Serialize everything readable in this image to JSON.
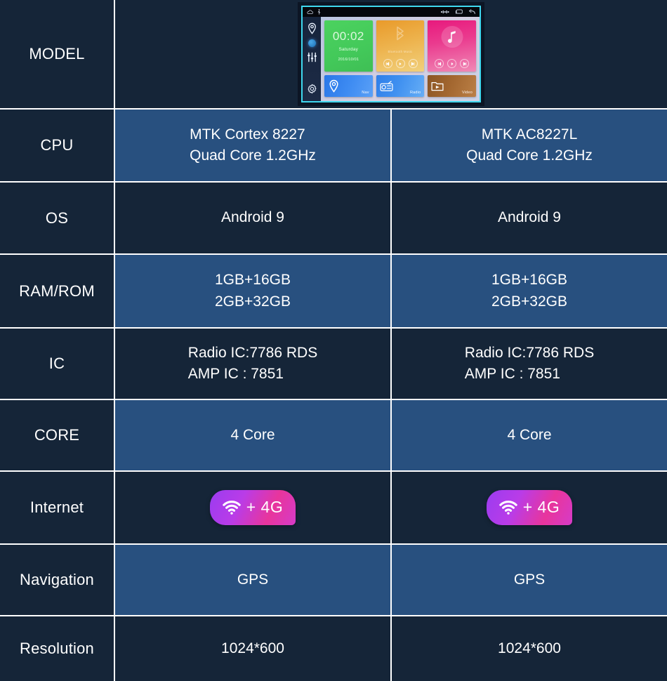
{
  "table": {
    "rows": [
      {
        "label": "MODEL",
        "type": "media",
        "col1": "",
        "col2": ""
      },
      {
        "label": "CPU",
        "type": "text-left",
        "highlight": true,
        "col1_lines": [
          "MTK Cortex 8227",
          "Quad Core 1.2GHz"
        ],
        "col2_lines": [
          "MTK AC8227L",
          "Quad Core 1.2GHz"
        ]
      },
      {
        "label": "OS",
        "type": "text",
        "highlight": false,
        "col1_lines": [
          "Android 9"
        ],
        "col2_lines": [
          "Android 9"
        ]
      },
      {
        "label": "RAM/ROM",
        "type": "text",
        "highlight": true,
        "col1_lines": [
          "1GB+16GB",
          "2GB+32GB"
        ],
        "col2_lines": [
          "1GB+16GB",
          "2GB+32GB"
        ]
      },
      {
        "label": "IC",
        "type": "text-left",
        "highlight": false,
        "col1_lines": [
          "Radio IC:7786 RDS",
          "AMP IC : 7851"
        ],
        "col2_lines": [
          "Radio IC:7786 RDS",
          "AMP IC : 7851"
        ]
      },
      {
        "label": "CORE",
        "type": "text",
        "highlight": true,
        "col1_lines": [
          "4 Core"
        ],
        "col2_lines": [
          "4 Core"
        ]
      },
      {
        "label": "Internet",
        "type": "badge",
        "highlight": false,
        "col1_badge": "+ 4G",
        "col2_badge": "+ 4G"
      },
      {
        "label": "Navigation",
        "type": "text",
        "highlight": true,
        "col1_lines": [
          "GPS"
        ],
        "col2_lines": [
          "GPS"
        ]
      },
      {
        "label": "Resolution",
        "type": "text",
        "highlight": false,
        "col1_lines": [
          "1024*600"
        ],
        "col2_lines": [
          "1024*600"
        ]
      }
    ]
  },
  "stereo": {
    "status_icons": [
      "cloud-icon",
      "usb-icon",
      "volume-icon",
      "recent-apps-icon",
      "back-icon"
    ],
    "rail_icons": [
      "location-pin-icon",
      "indicator-dot",
      "equalizer-icon",
      "gear-icon"
    ],
    "clock": {
      "time": "00:02",
      "day": "Saturday",
      "date": "2016/10/01"
    },
    "bt_widget": {
      "name": "Bluetooth Music"
    },
    "shortcuts": [
      {
        "label": "Nav",
        "icon": "location-pin-icon"
      },
      {
        "label": "Radio",
        "icon": "radio-icon"
      },
      {
        "label": "Video",
        "icon": "video-folder-icon"
      }
    ]
  },
  "colors": {
    "dark_cell": "#152538",
    "light_cell": "#28507f",
    "grid_line": "#ffffff",
    "text": "#ffffff",
    "badge_start": "#9b3cf0",
    "badge_end": "#e8359c",
    "screen_bezel": "#3fd8ef"
  }
}
